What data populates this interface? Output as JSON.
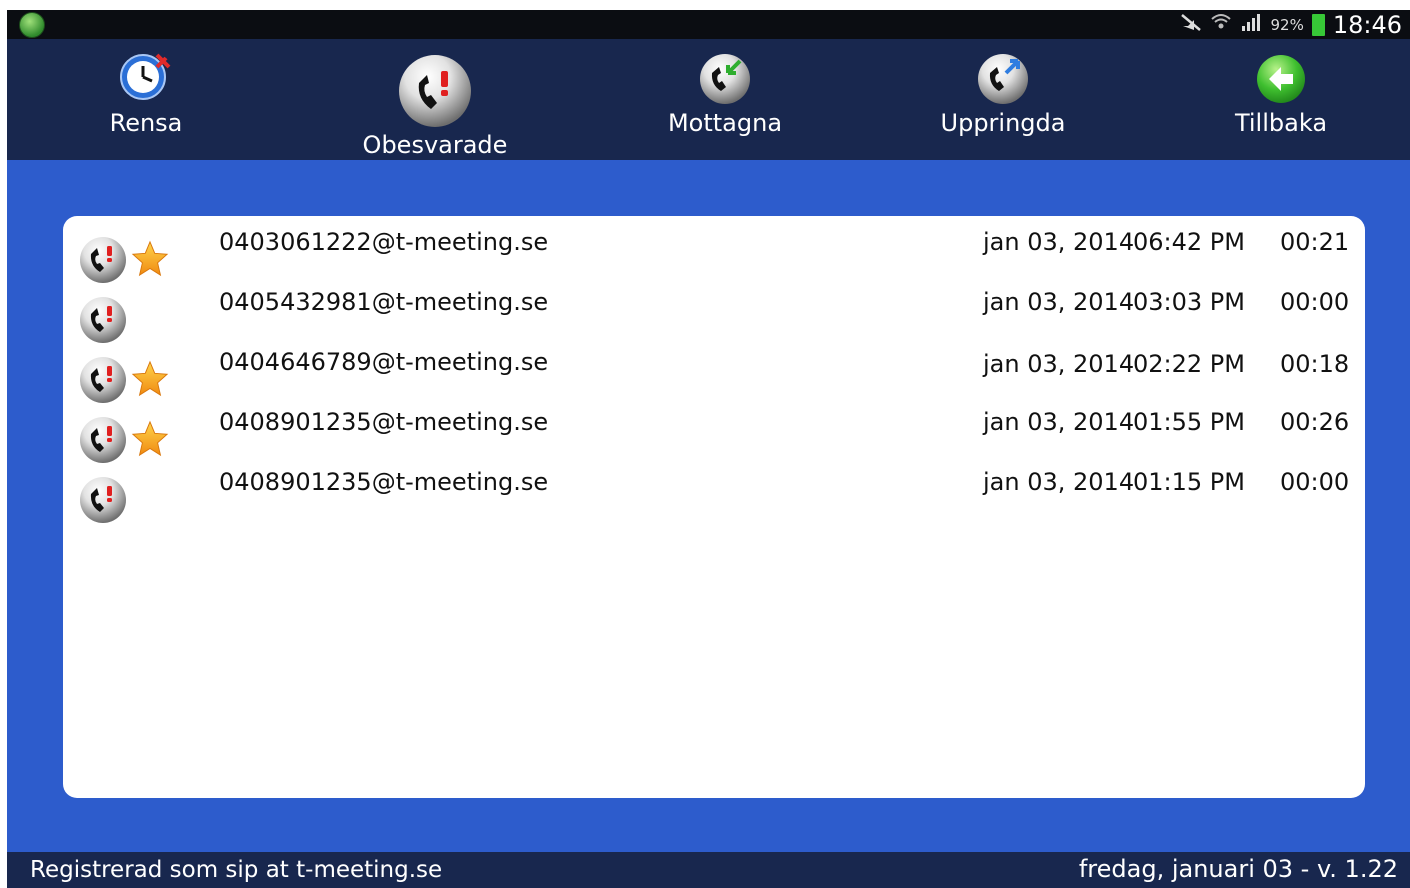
{
  "statusbar": {
    "battery": "92%",
    "time": "18:46"
  },
  "toolbar": {
    "clear": "Rensa",
    "missed": "Obesvarade",
    "received": "Mottagna",
    "dialed": "Uppringda",
    "back": "Tillbaka"
  },
  "calls": [
    {
      "address": "0403061222@t-meeting.se",
      "date": "jan 03, 2014",
      "time": "06:42 PM",
      "duration": "00:21",
      "starred": true
    },
    {
      "address": "0405432981@t-meeting.se",
      "date": "jan 03, 2014",
      "time": "03:03 PM",
      "duration": "00:00",
      "starred": false
    },
    {
      "address": "0404646789@t-meeting.se",
      "date": "jan 03, 2014",
      "time": "02:22 PM",
      "duration": "00:18",
      "starred": true
    },
    {
      "address": "0408901235@t-meeting.se",
      "date": "jan 03, 2014",
      "time": "01:55 PM",
      "duration": "00:26",
      "starred": true
    },
    {
      "address": "0408901235@t-meeting.se",
      "date": "jan 03, 2014",
      "time": "01:15 PM",
      "duration": "00:00",
      "starred": false
    }
  ],
  "footer": {
    "registration": "Registrerad som sip at t-meeting.se",
    "date_version": "fredag, januari 03 - v. 1.22"
  },
  "colors": {
    "toolbar": "#18274e",
    "body": "#2d5ccc",
    "panel": "#ffffff",
    "missed_mark": "#e02020",
    "star": "#f5a623"
  }
}
